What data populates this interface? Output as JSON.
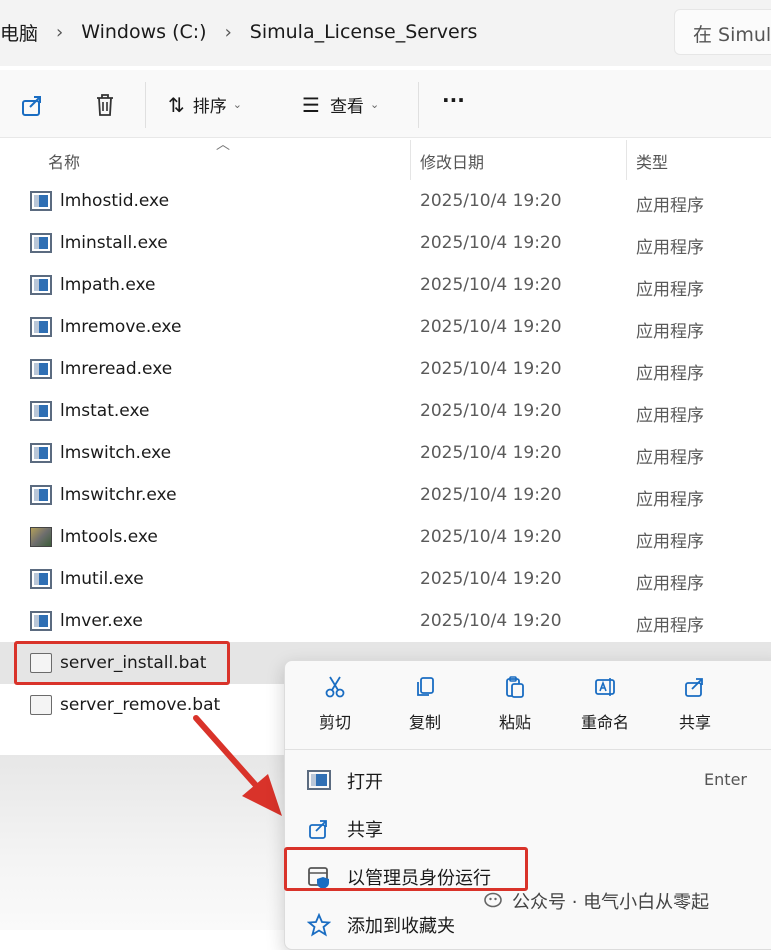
{
  "address": {
    "crumbs": [
      "电脑",
      "Windows (C:)",
      "Simula_License_Servers"
    ],
    "search_placeholder": "在 Simul"
  },
  "toolbar": {
    "share_icon": "share-icon",
    "delete_icon": "trash-icon",
    "sort_label": "排序",
    "view_label": "查看",
    "more_label": "···"
  },
  "columns": {
    "name": "名称",
    "modified": "修改日期",
    "type": "类型"
  },
  "files": [
    {
      "name": "lmhostid.exe",
      "date": "2025/10/4 19:20",
      "type": "应用程序",
      "icon": "exe"
    },
    {
      "name": "lminstall.exe",
      "date": "2025/10/4 19:20",
      "type": "应用程序",
      "icon": "exe"
    },
    {
      "name": "lmpath.exe",
      "date": "2025/10/4 19:20",
      "type": "应用程序",
      "icon": "exe"
    },
    {
      "name": "lmremove.exe",
      "date": "2025/10/4 19:20",
      "type": "应用程序",
      "icon": "exe"
    },
    {
      "name": "lmreread.exe",
      "date": "2025/10/4 19:20",
      "type": "应用程序",
      "icon": "exe"
    },
    {
      "name": "lmstat.exe",
      "date": "2025/10/4 19:20",
      "type": "应用程序",
      "icon": "exe"
    },
    {
      "name": "lmswitch.exe",
      "date": "2025/10/4 19:20",
      "type": "应用程序",
      "icon": "exe"
    },
    {
      "name": "lmswitchr.exe",
      "date": "2025/10/4 19:20",
      "type": "应用程序",
      "icon": "exe"
    },
    {
      "name": "lmtools.exe",
      "date": "2025/10/4 19:20",
      "type": "应用程序",
      "icon": "tools"
    },
    {
      "name": "lmutil.exe",
      "date": "2025/10/4 19:20",
      "type": "应用程序",
      "icon": "exe"
    },
    {
      "name": "lmver.exe",
      "date": "2025/10/4 19:20",
      "type": "应用程序",
      "icon": "exe"
    },
    {
      "name": "server_install.bat",
      "date": "",
      "type": "",
      "icon": "bat"
    },
    {
      "name": "server_remove.bat",
      "date": "",
      "type": "",
      "icon": "bat"
    }
  ],
  "context_menu": {
    "quick_actions": [
      "剪切",
      "复制",
      "粘贴",
      "重命名",
      "共享"
    ],
    "items": [
      {
        "label": "打开",
        "accelerator": "Enter",
        "icon": "open-icon"
      },
      {
        "label": "共享",
        "accelerator": "",
        "icon": "share-icon"
      },
      {
        "label": "以管理员身份运行",
        "accelerator": "",
        "icon": "shield-run-icon"
      },
      {
        "label": "添加到收藏夹",
        "accelerator": "",
        "icon": "star-icon"
      }
    ]
  },
  "watermark": "公众号 · 电气小白从零起",
  "colors": {
    "highlight": "#d9332a",
    "selected_row": "#e5e5e5",
    "exe_blue": "#2f6fb4"
  }
}
